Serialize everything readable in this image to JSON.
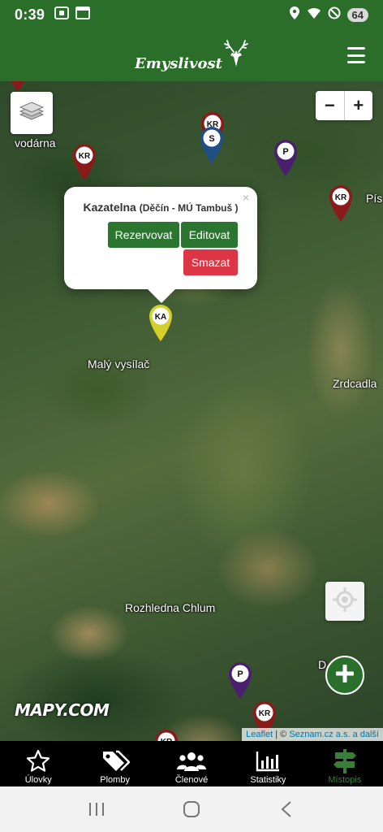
{
  "status_bar": {
    "time": "0:39",
    "battery": "64"
  },
  "header": {
    "brand": "Emyslivost"
  },
  "map": {
    "places": [
      "vodárna",
      "Malý vysílač",
      "Zrdcadla",
      "Rozhledna Chlum",
      "Pís",
      "D"
    ],
    "markers": [
      {
        "label": "KR",
        "color": "#8b1a1a"
      },
      {
        "label": "KR",
        "color": "#8b1a1a"
      },
      {
        "label": "S",
        "color": "#1f4f85"
      },
      {
        "label": "P",
        "color": "#4a1f6e"
      },
      {
        "label": "KR",
        "color": "#8b1a1a"
      },
      {
        "label": "KA",
        "color": "#d4cf2a"
      },
      {
        "label": "P",
        "color": "#4a1f6e"
      },
      {
        "label": "KR",
        "color": "#8b1a1a"
      },
      {
        "label": "KR",
        "color": "#8b1a1a"
      }
    ],
    "zoom_in": "+",
    "zoom_out": "−",
    "logo": "MAPY.COM",
    "attribution": {
      "leaflet": "Leaflet",
      "separator": " | © ",
      "source": "Seznam.cz a.s. a další"
    }
  },
  "popup": {
    "title": "Kazatelna",
    "subtitle": "(Děčín - MÚ Tambuš )",
    "close": "×",
    "reserve_label": "Rezervovat",
    "edit_label": "Editovat",
    "delete_label": "Smazat"
  },
  "tabs": [
    {
      "label": "Úlovky",
      "icon": "star-icon"
    },
    {
      "label": "Plomby",
      "icon": "tags-icon"
    },
    {
      "label": "Členové",
      "icon": "users-icon"
    },
    {
      "label": "Statistiky",
      "icon": "chart-icon"
    },
    {
      "label": "Místopis",
      "icon": "signpost-icon"
    }
  ],
  "colors": {
    "header": "#2b6e2a",
    "accent_green": "#2b7530",
    "danger": "#dc3545",
    "active_tab": "#3a7d3a"
  }
}
